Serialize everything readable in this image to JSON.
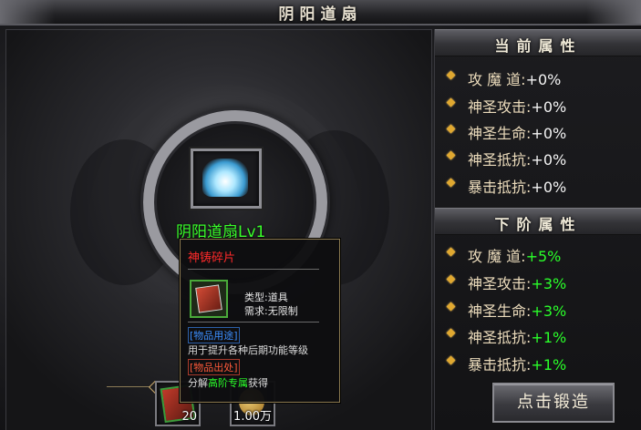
{
  "window": {
    "title": "阴阳道扇"
  },
  "item": {
    "name": "阴阳道扇Lv1",
    "icon": "fan-icon"
  },
  "tooltip": {
    "name": "神铸碎片",
    "type_label": "类型:",
    "type_value": "道具",
    "req_label": "需求:",
    "req_value": "无限制",
    "usage_tag": "[物品用途]",
    "usage_text": "用于提升各种后期功能等级",
    "source_tag": "[物品出处]",
    "source_pre": "分解",
    "source_hl": "高阶专属",
    "source_post": "获得"
  },
  "materials": [
    {
      "icon": "shard-icon",
      "count": "20"
    },
    {
      "icon": "gold-coin-icon",
      "count": "1.00万"
    }
  ],
  "current": {
    "header": "当前属性",
    "stats": [
      {
        "label": "攻 魔 道:",
        "value": "+0%"
      },
      {
        "label": "神圣攻击:",
        "value": "+0%"
      },
      {
        "label": "神圣生命:",
        "value": "+0%"
      },
      {
        "label": "神圣抵抗:",
        "value": "+0%"
      },
      {
        "label": "暴击抵抗:",
        "value": "+0%"
      }
    ]
  },
  "next": {
    "header": "下阶属性",
    "stats": [
      {
        "label": "攻 魔 道:",
        "value": "+5%"
      },
      {
        "label": "神圣攻击:",
        "value": "+3%"
      },
      {
        "label": "神圣生命:",
        "value": "+3%"
      },
      {
        "label": "神圣抵抗:",
        "value": "+1%"
      },
      {
        "label": "暴击抵抗:",
        "value": "+1%"
      }
    ]
  },
  "actions": {
    "forge_label": "点击锻造"
  },
  "colors": {
    "green": "#2aff2a",
    "red": "#ff2a2a",
    "gold": "#e0a830"
  }
}
